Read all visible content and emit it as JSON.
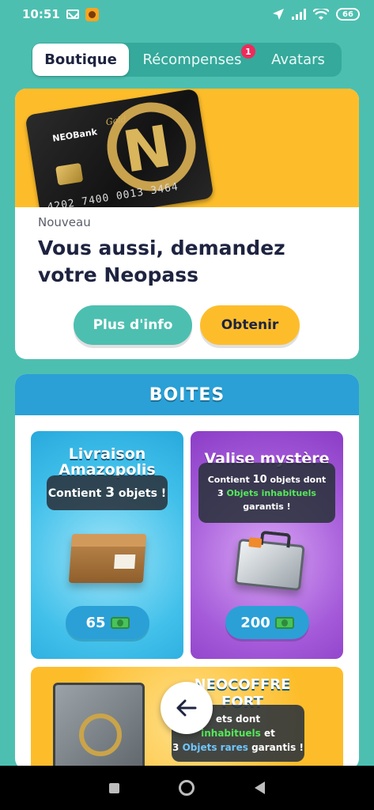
{
  "status_bar": {
    "time": "10:51",
    "battery": "66"
  },
  "tabs": [
    {
      "label": "Boutique"
    },
    {
      "label": "Récompenses",
      "badge": "1"
    },
    {
      "label": "Avatars"
    }
  ],
  "promo": {
    "card": {
      "bank_name": "NEOBank",
      "tier": "Gold",
      "number": "4202 7400 0013 3464",
      "logo_letter": "N"
    },
    "kicker": "Nouveau",
    "title": "Vous aussi, demandez votre Neopass",
    "info_button": "Plus d'info",
    "get_button": "Obtenir"
  },
  "boxes": {
    "title": "BOITES",
    "items": [
      {
        "name_line1": "Livraison",
        "name_line2": "Amazopolis",
        "desc_prefix": "Contient ",
        "desc_count": "3",
        "desc_suffix": " objets !",
        "price": "65"
      },
      {
        "name": "Valise mystère",
        "desc_line1_prefix": "Contient ",
        "desc_line1_count": "10",
        "desc_line1_suffix": " objets dont",
        "desc_line2_count": "3",
        "desc_line2_highlight": "Objets inhabituels",
        "desc_line2_suffix": "garantis !",
        "price": "200"
      },
      {
        "name_line1": "NEOCOFFRE",
        "name_line2": "FORT",
        "desc_line1": "ets dont",
        "desc_line2_highlight": "inhabituels",
        "desc_line2_suffix": "et",
        "desc_line3_count": "3",
        "desc_line3_highlight": "Objets rares",
        "desc_line3_suffix": "garantis !"
      }
    ]
  },
  "colors": {
    "background": "#4dbfb0",
    "accent_yellow": "#fdbd2b",
    "accent_blue": "#2aa0d6",
    "accent_purple": "#a45ad9",
    "badge_red": "#ef2a5b"
  }
}
